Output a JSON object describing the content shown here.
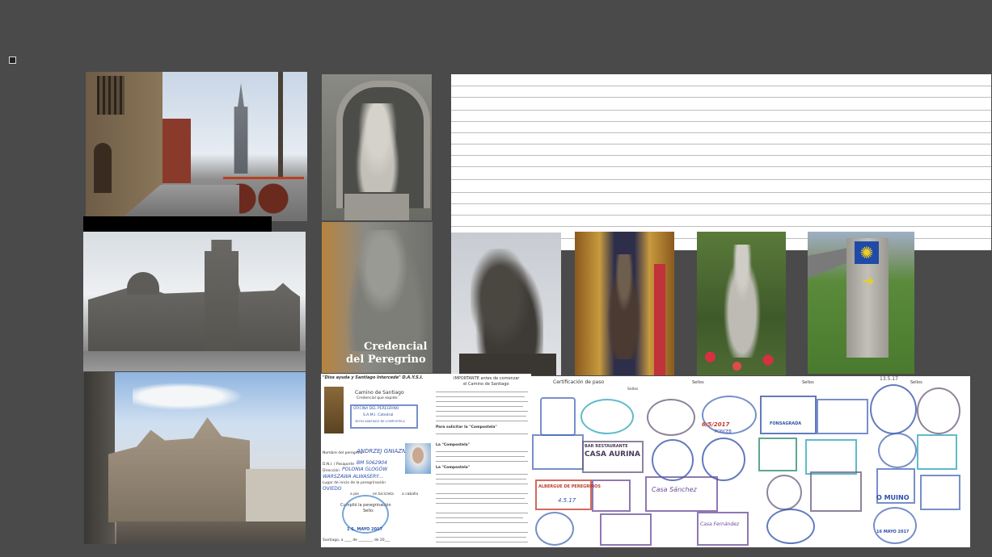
{
  "credential_cover": {
    "line1": "Credencial",
    "line2": "del Peregrino"
  },
  "credential_doc": {
    "motto": "\"Dios ayuda y Santiago Intercede\" D.A.Y.S.I.",
    "org_title": "Camino de Santiago",
    "org_sub": "Credencial que expide:",
    "office_1": "OFICINA DEL PEREGRINO",
    "office_2": "S.A.M.I. Catedral",
    "office_3": "36704 SANTIAGO DE COMPOSTELA",
    "field_name_label": "Nombre del peregrino",
    "field_name_value": "ANDRZEJ GNIAZN",
    "field_passport_label": "D.N.I. / Pasaporte",
    "field_passport_value": "BM 5062904",
    "field_address_label": "Dirección",
    "field_address_value": "POLONIA GLOGÓW",
    "field_address2_value": "WARSZAWA ALWASERY...",
    "field_start_label": "Lugar de inicio de la peregrinación",
    "field_start_value": "OVIEDO",
    "mode_foot": "a pie",
    "mode_bike": "en bicicleta",
    "mode_horse": "a caballo",
    "fulfilled": "Cumplió la peregrinación",
    "seal_label": "Sello:",
    "date_line": "Santiago, a ____ de ________ de 20___",
    "stamp_date": "1 6. MAYO 2017"
  },
  "info_doc": {
    "heading1": "IMPORTANTE antes de comenzar",
    "heading2": "el Camino de Santiago",
    "p1_bold": "La \"Compostela\"",
    "p2_bold": "Para solicitar la \"Compostela\"",
    "p3_bold": "La \"Compostela\""
  },
  "stamps_doc": {
    "title": "Certificación de paso",
    "col_1": "Sellos",
    "col_2": "Sellos",
    "col_3": "Sellos",
    "col_4": "Sellos",
    "stamp_fonsagrada": "FONSAGRADA",
    "stamp_bar": "BAR RESTAURANTE",
    "stamp_aurina": "CASA AURINA",
    "stamp_albergue": "ALBERGUE DE PEREGRINOS",
    "stamp_muino": "O MUINO",
    "stamp_date_1": "6/5/2017",
    "stamp_date_2": "13.5.17",
    "stamp_date_3": "16 MAYO 2017",
    "stamp_date_4": "4.5.17",
    "stamp_sanchez": "Casa Sánchez",
    "stamp_fernandez": "Casa Fernández",
    "stamp_ponte": "PONCEB"
  },
  "colors": {
    "background": "#4a4a4a",
    "panel": "#ffffff",
    "ink_blue": "#2e4fa8",
    "ink_purple": "#6a4a9a",
    "ink_red": "#c0392b",
    "ink_green": "#2a8a6a",
    "ink_cyan": "#2aa4b8"
  }
}
